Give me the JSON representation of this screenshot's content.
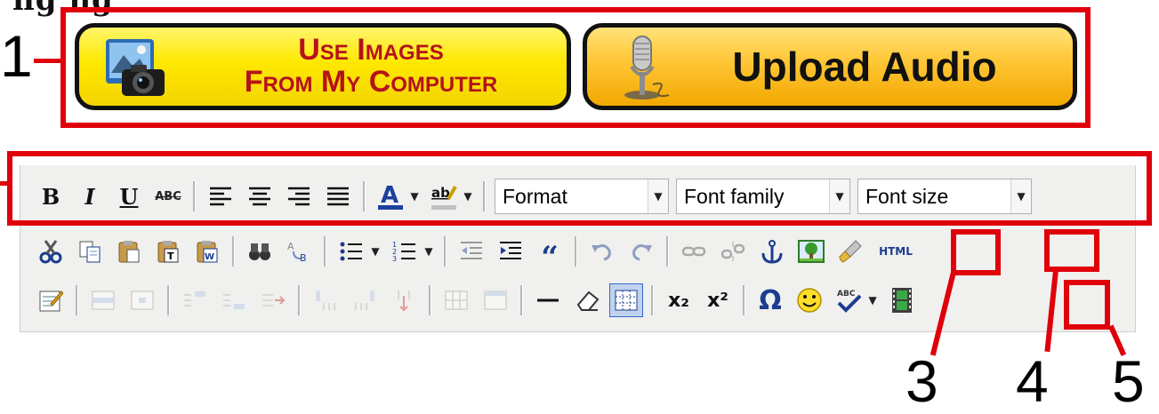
{
  "heading_partial": "ng ng",
  "callouts": [
    "1",
    "3",
    "4",
    "5"
  ],
  "buttons": {
    "use_images_line1": "Use Images",
    "use_images_line2": "From My Computer",
    "upload_audio": "Upload Audio"
  },
  "toolbar": {
    "bold": "B",
    "italic": "I",
    "underline": "U",
    "strike": "ABC",
    "format_value": "Format",
    "font_family_value": "Font family",
    "font_size_value": "Font size",
    "html_label": "HTML",
    "omega": "Ω",
    "subscript": "x₂",
    "superscript": "x²",
    "blockquote": "“"
  },
  "colors": {
    "callout_red": "#e0000b",
    "toolbar_bg": "#f0f0ee"
  }
}
